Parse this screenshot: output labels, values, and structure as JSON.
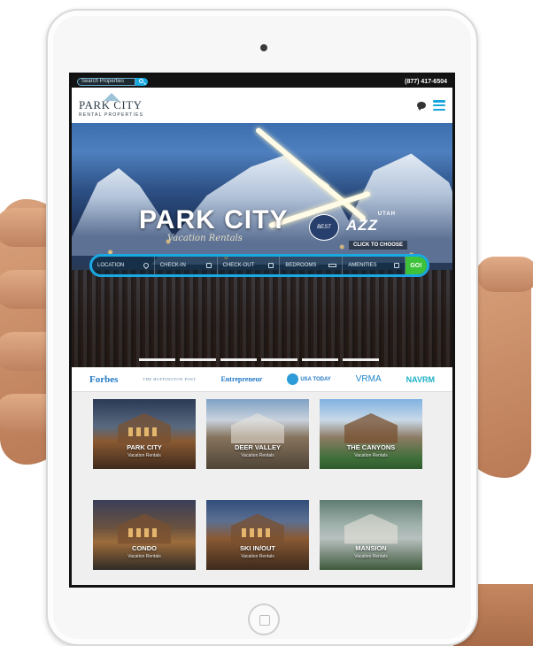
{
  "topbar": {
    "search_placeholder": "Search Properties",
    "phone": "(877) 417-6504"
  },
  "header": {
    "logo_name": "PARK CITY",
    "logo_sub": "RENTAL PROPERTIES",
    "chat_icon": "chat-icon",
    "menu_icon": "hamburger-menu-icon",
    "accent": "#18a7dd"
  },
  "hero": {
    "title": "PARK CITY",
    "script": "Vacation Rentals",
    "badge": "BEST",
    "utah_small": "UTAH",
    "utah_big": "AZZ",
    "choose": "CLICK TO CHOOSE",
    "fields": [
      {
        "label": "LOCATION",
        "icon": "pin-icon"
      },
      {
        "label": "CHECK-IN",
        "icon": "calendar-icon"
      },
      {
        "label": "CHECK-OUT",
        "icon": "calendar-icon"
      },
      {
        "label": "BEDROOMS",
        "icon": "bed-icon"
      },
      {
        "label": "AMENITIES",
        "icon": "checkbox-icon"
      }
    ],
    "go": "GO!",
    "go_color": "#3dc23a",
    "slides": 6
  },
  "press": {
    "forbes": "Forbes",
    "huff": "THE HUFFINGTON POST",
    "entrepreneur": "Entrepreneur",
    "usa": "USA TODAY",
    "vrma": "VRMA",
    "navrm": "NAVRM"
  },
  "tiles": [
    {
      "name": "PARK CITY",
      "sub": "Vacation Rentals"
    },
    {
      "name": "DEER VALLEY",
      "sub": "Vacation Rentals"
    },
    {
      "name": "THE CANYONS",
      "sub": "Vacation Rentals"
    },
    {
      "name": "CONDO",
      "sub": "Vacation Rentals"
    },
    {
      "name": "SKI IN/OUT",
      "sub": "Vacation Rentals"
    },
    {
      "name": "MANSION",
      "sub": "Vacation Rentals"
    }
  ]
}
